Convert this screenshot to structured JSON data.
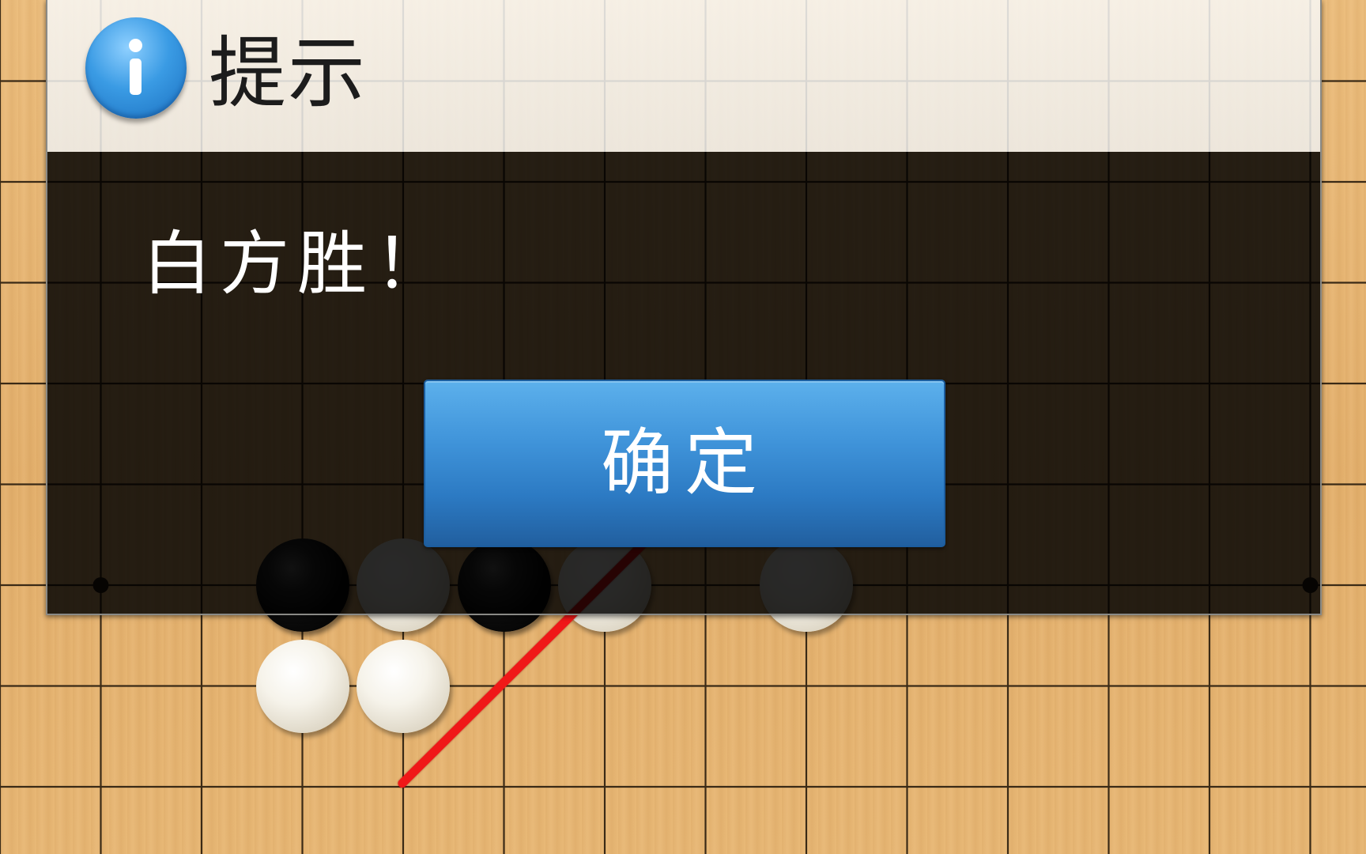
{
  "board": {
    "stones_below_dialog": [
      {
        "color": "black",
        "row": 6,
        "col": 3
      },
      {
        "color": "white",
        "row": 6,
        "col": 4
      },
      {
        "color": "black",
        "row": 6,
        "col": 5
      },
      {
        "color": "white",
        "row": 6,
        "col": 6
      },
      {
        "color": "white",
        "row": 6,
        "col": 8
      },
      {
        "color": "white",
        "row": 7,
        "col": 3
      },
      {
        "color": "white",
        "row": 7,
        "col": 4
      }
    ],
    "winning_line_color": "#f01818"
  },
  "dialog": {
    "title": "提示",
    "icon": "info-icon",
    "message": "白方胜！",
    "ok_label": "确定"
  },
  "colors": {
    "board_wood": "#e6b36d",
    "button_blue": "#3f93d9",
    "overlay": "#000000"
  }
}
